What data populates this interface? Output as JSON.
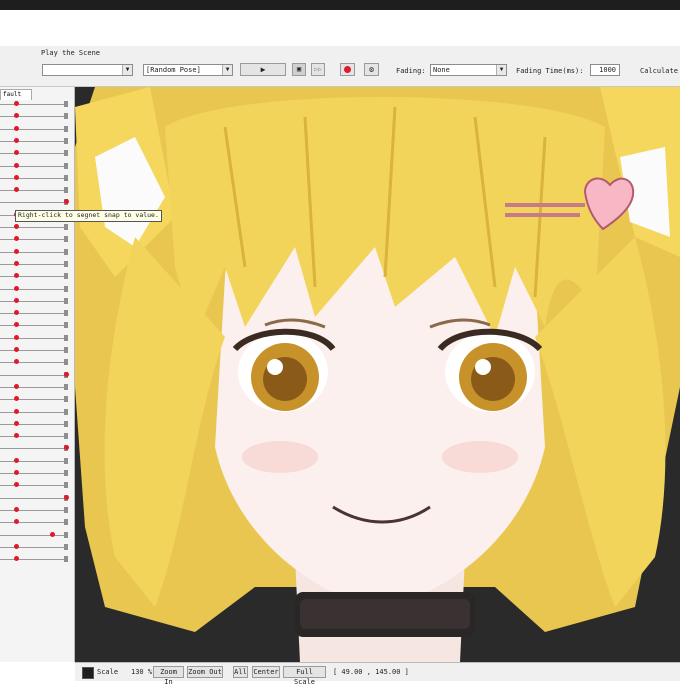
{
  "toolbar": {
    "play_scene_label": "Play the Scene",
    "scene_combo_value": "",
    "pose_combo_value": "[Random Pose]",
    "fading_label": "Fading:",
    "fading_value": "None",
    "fading_time_label": "Fading Time(ms):",
    "fading_time_value": "1000",
    "calculate_label": "Calculate"
  },
  "left_panel": {
    "tab_label": "fault",
    "tooltip": "Right-click to segnet snap to value."
  },
  "status_bar": {
    "scale_label": "Scale",
    "scale_value": "130 %",
    "zoom_in": "Zoom In",
    "zoom_out": "Zoom Out",
    "all": "All",
    "center": "Center",
    "full_scale": "Full Scale",
    "coordinates": "[  49.00 ,  145.00 ]"
  },
  "colors": {
    "accent_red": "#e0192b",
    "hair": "#f3d45a",
    "eyes": "#c8922a",
    "background_canvas": "#2a2a2a"
  }
}
